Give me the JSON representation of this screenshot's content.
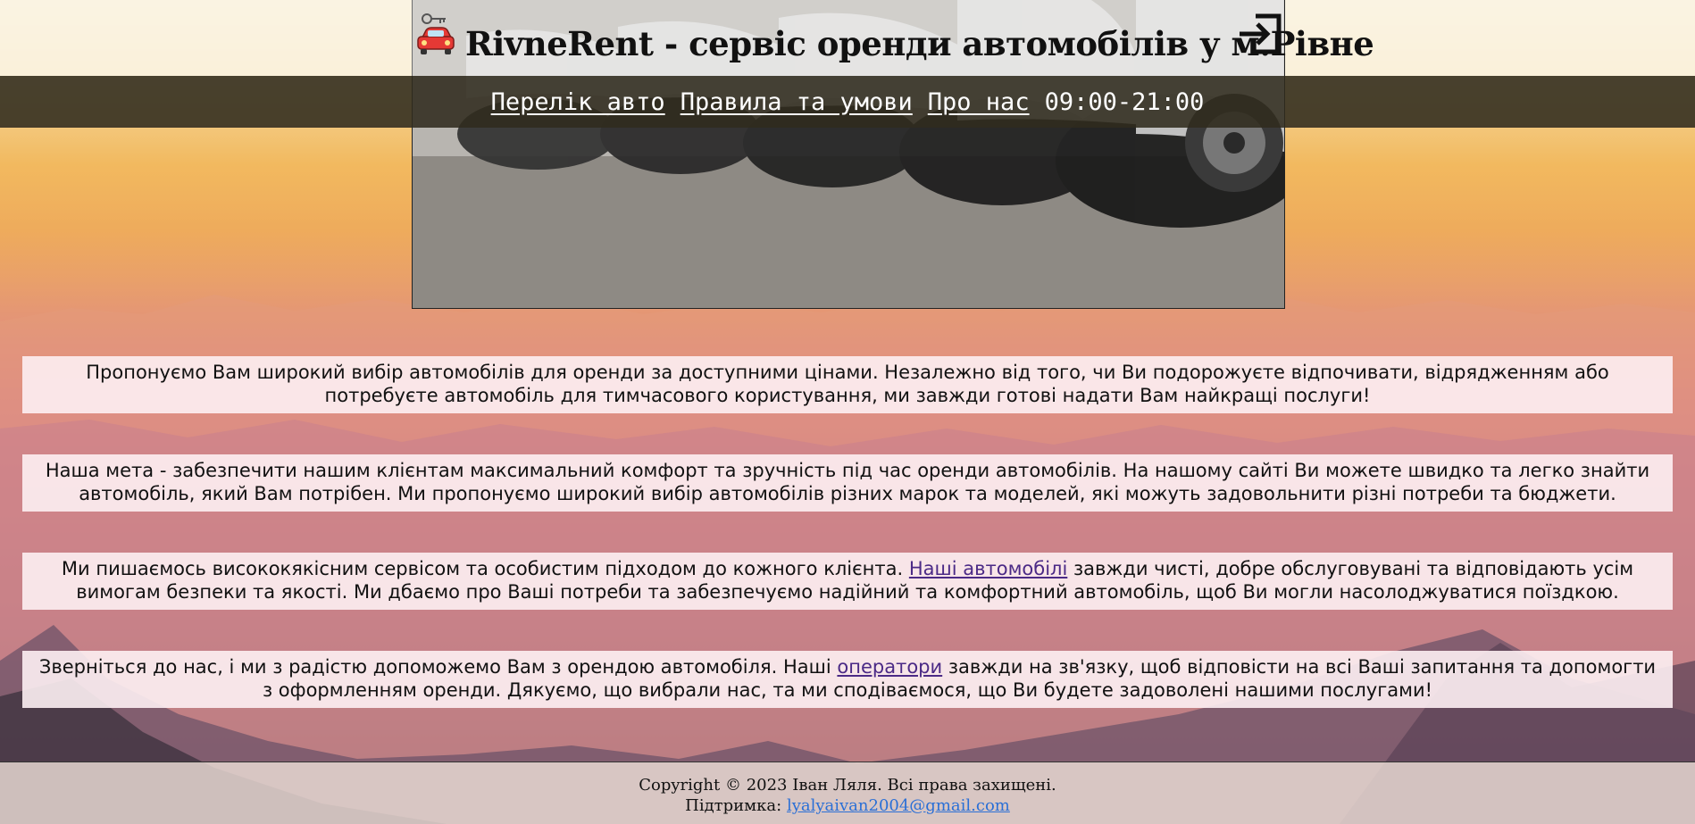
{
  "header": {
    "title": "RivneRent - сервіс оренди автомобілів у м.Рівне",
    "logo_icon": "car-key-icon",
    "login_icon": "sign-in-icon"
  },
  "nav": {
    "items": [
      {
        "label": "Перелік авто"
      },
      {
        "label": "Правила та умови"
      },
      {
        "label": "Про нас"
      }
    ],
    "hours": "09:00-21:00"
  },
  "content": {
    "p1": "Пропонуємо Вам широкий вибір автомобілів для оренди за доступними цінами. Незалежно від того, чи Ви подорожуєте відпочивати, відрядженням або потребуєте автомобіль для тимчасового користування, ми завжди готові надати Вам найкращі послуги!",
    "p2": "Наша мета - забезпечити нашим клієнтам максимальний комфорт та зручність під час оренди автомобілів. На нашому сайті Ви можете швидко та легко знайти автомобіль, який Вам потрібен. Ми пропонуємо широкий вибір автомобілів різних марок та моделей, які можуть задовольнити різні потреби та бюджети.",
    "p3_before": "Ми пишаємось висококякісним сервісом та особистим підходом до кожного клієнта.",
    "p3_link": "Наші автомобілі",
    "p3_after": "завжди чисті, добре обслуговувані та відповідають усім вимогам безпеки та якості. Ми дбаємо про Ваші потреби та забезпечуємо надійний та комфортний автомобіль, щоб Ви могли насолоджуватися поїздкою.",
    "p4_before": "Зверніться до нас, і ми з радістю допоможемо Вам з орендою автомобіля. Наші",
    "p4_link": "оператори",
    "p4_after": "завжди на зв'язку, щоб відповісти на всі Ваші запитання та допомогти з оформленням оренди. Дякуємо, що вибрали нас, та ми сподіваємося, що Ви будете задоволені нашими послугами!"
  },
  "footer": {
    "copyright": "Copyright © 2023 Іван Ляля. Всі права захищені.",
    "support_label": "Підтримка:",
    "support_email": "lyalyaivan2004@gmail.com"
  },
  "colors": {
    "nav_band": "#302b1e",
    "link": "#4b2a86",
    "footer_link": "#2a6fd6",
    "box_bg": "#fdf0f3"
  }
}
